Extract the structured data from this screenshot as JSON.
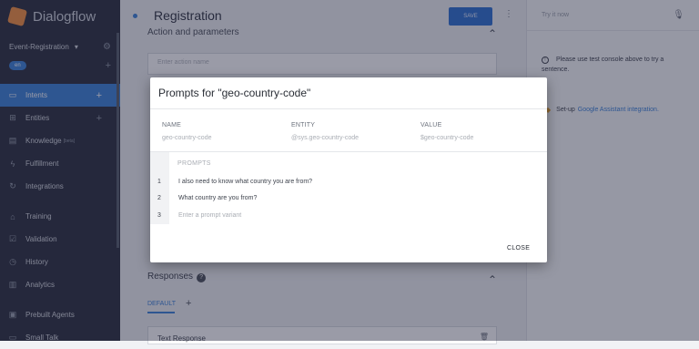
{
  "app": {
    "brand": "Dialogflow"
  },
  "sidebar": {
    "agent": "Event-Registration",
    "language": "en",
    "items": [
      {
        "label": "Intents",
        "icon": "chat-bubble-icon"
      },
      {
        "label": "Entities",
        "icon": "entities-icon"
      },
      {
        "label": "Knowledge",
        "icon": "book-icon",
        "badge": "[beta]"
      },
      {
        "label": "Fulfillment",
        "icon": "bolt-icon"
      },
      {
        "label": "Integrations",
        "icon": "integrations-icon"
      },
      {
        "label": "Training",
        "icon": "training-icon"
      },
      {
        "label": "Validation",
        "icon": "validation-icon"
      },
      {
        "label": "History",
        "icon": "clock-icon"
      },
      {
        "label": "Analytics",
        "icon": "chart-icon"
      },
      {
        "label": "Prebuilt Agents",
        "icon": "prebuilt-icon"
      },
      {
        "label": "Small Talk",
        "icon": "smalltalk-icon"
      }
    ]
  },
  "main": {
    "title": "Registration",
    "save_label": "SAVE",
    "section_title": "Action and parameters",
    "action_placeholder": "Enter action name",
    "responses_title": "Responses",
    "responses_tab": "DEFAULT",
    "text_response": "Text Response"
  },
  "console": {
    "try_placeholder": "Try it now",
    "message": "Please use test console above to try a sentence.",
    "setup_prefix": "Set-up",
    "setup_link": "Google Assistant integration."
  },
  "dialog": {
    "title": "Prompts for \"geo-country-code\"",
    "name_label": "NAME",
    "name_value": "geo-country-code",
    "entity_label": "ENTITY",
    "entity_value": "@sys.geo-country-code",
    "value_label": "VALUE",
    "value_value": "$geo-country-code",
    "prompts_label": "PROMPTS",
    "prompts": [
      {
        "num": "1",
        "text": "I also need to know what country you are from?"
      },
      {
        "num": "2",
        "text": "What country are you from?"
      }
    ],
    "new_prompt_num": "3",
    "new_prompt_placeholder": "Enter a prompt variant",
    "close_label": "CLOSE"
  },
  "colors": {
    "accent": "#3b82d8",
    "sidebar": "#2a2f3d",
    "brand_orange": "#f5913e"
  }
}
